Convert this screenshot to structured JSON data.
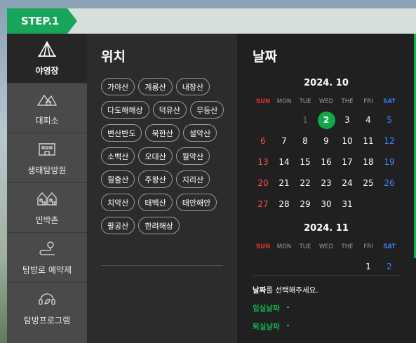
{
  "step": {
    "label": "STEP.1"
  },
  "sidebar": {
    "items": [
      {
        "label": "야영장",
        "icon": "tent-icon",
        "active": true
      },
      {
        "label": "대피소",
        "icon": "mountain-shelter-icon"
      },
      {
        "label": "생태탐방원",
        "icon": "building-icon"
      },
      {
        "label": "민박촌",
        "icon": "houses-icon"
      },
      {
        "label": "탐방로 예약제",
        "icon": "trail-pin-icon"
      },
      {
        "label": "탐방프로그램",
        "icon": "headset-icon"
      }
    ]
  },
  "location": {
    "title": "위치",
    "parks": [
      "가야산",
      "계룡산",
      "내장산",
      "다도해해상",
      "덕유산",
      "무등산",
      "변산반도",
      "북한산",
      "설악산",
      "소백산",
      "오대산",
      "월악산",
      "월출산",
      "주왕산",
      "지리산",
      "치악산",
      "태백산",
      "태안해안",
      "팔공산",
      "한려해상"
    ]
  },
  "date": {
    "title": "날짜",
    "weekdays": [
      "SUN",
      "MON",
      "TUE",
      "WED",
      "THE",
      "FRI",
      "SAT"
    ],
    "months": [
      {
        "title": "2024. 10",
        "weeks": [
          [
            "",
            "",
            "1",
            "2",
            "3",
            "4",
            "5"
          ],
          [
            "6",
            "7",
            "8",
            "9",
            "10",
            "11",
            "12"
          ],
          [
            "13",
            "14",
            "15",
            "16",
            "17",
            "18",
            "19"
          ],
          [
            "20",
            "21",
            "22",
            "23",
            "24",
            "25",
            "26"
          ],
          [
            "27",
            "28",
            "29",
            "30",
            "31",
            "",
            ""
          ]
        ],
        "selected": "2",
        "dimmed": [
          "1"
        ]
      },
      {
        "title": "2024. 11",
        "weeks": [
          [
            "",
            "",
            "",
            "",
            "",
            "1",
            "2"
          ]
        ]
      }
    ],
    "prompt_bold": "날짜",
    "prompt_rest": "를 선택해주세요.",
    "checkin_label": "입실날짜",
    "checkin_value": "-",
    "checkout_label": "퇴실날짜",
    "checkout_value": "-"
  },
  "colors": {
    "accent": "#12b04f",
    "sunday": "#ff4d4d",
    "saturday": "#3d86ff"
  }
}
